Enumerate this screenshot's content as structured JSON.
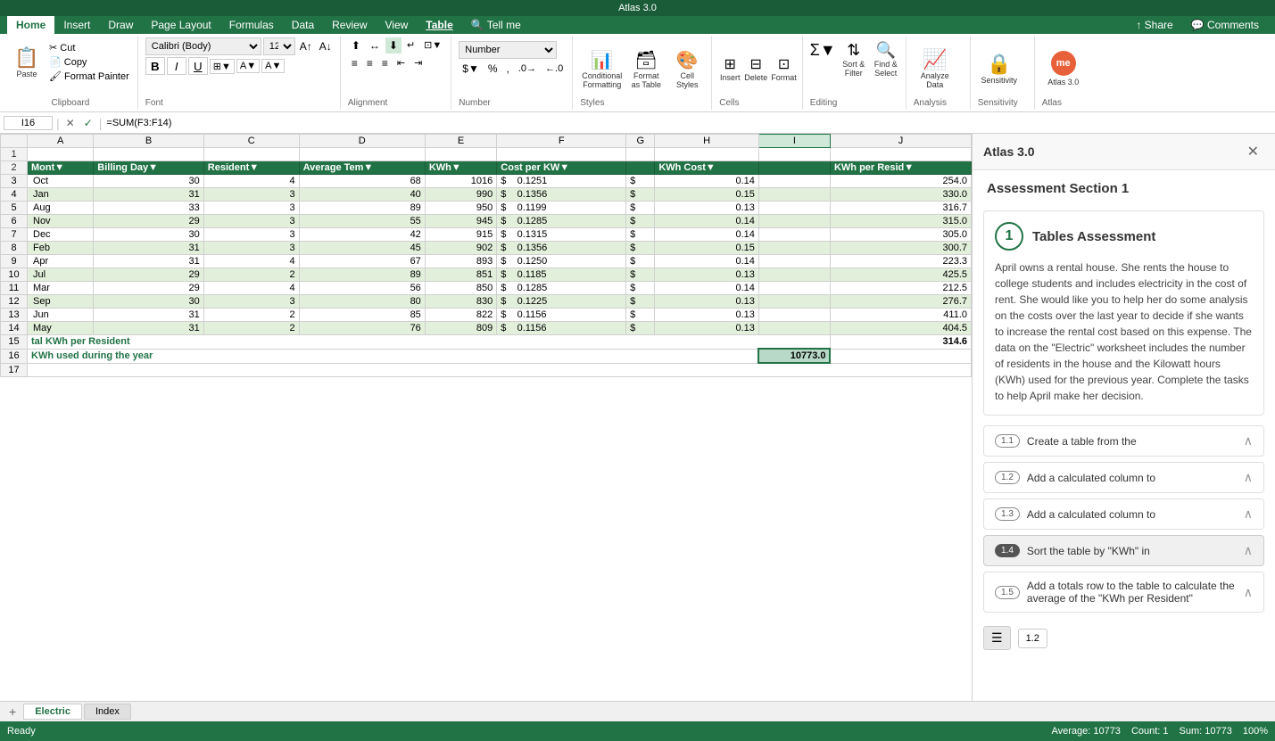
{
  "app": {
    "title": "Atlas 3.0",
    "close_label": "✕"
  },
  "ribbon": {
    "tabs": [
      "Home",
      "Insert",
      "Draw",
      "Page Layout",
      "Formulas",
      "Data",
      "Review",
      "View",
      "Table",
      "Tell me"
    ],
    "active_tab": "Home",
    "table_tab": "Table",
    "font_name": "Calibri (Body)",
    "font_size": "12",
    "number_format": "Number",
    "groups": {
      "clipboard": "Clipboard",
      "font": "Font",
      "alignment": "Alignment",
      "number": "Number",
      "styles": "Styles",
      "cells": "Cells",
      "editing": "Editing",
      "analysis": "Analysis",
      "sensitivity": "Sensitivity",
      "atlas": "Atlas"
    },
    "buttons": {
      "paste": "Paste",
      "conditional_formatting": "Conditional Formatting",
      "format_as_table": "Format as Table",
      "cell_styles": "Cell Styles",
      "insert": "Insert",
      "delete": "Delete",
      "format": "Format",
      "sum": "Σ",
      "sort_filter": "Sort & Filter",
      "find_select": "Find & Select",
      "analyze_data": "Analyze Data",
      "sensitivity": "Sensitivity",
      "atlas": "Atlas 3.0"
    }
  },
  "formula_bar": {
    "cell_ref": "I16",
    "check": "✓",
    "cancel": "✕",
    "formula": "=SUM(F3:F14)"
  },
  "spreadsheet": {
    "col_headers": [
      "",
      "A",
      "B",
      "C",
      "D",
      "E",
      "F",
      "G",
      "H",
      "I"
    ],
    "table_headers": [
      "Mont▼",
      "Billing Da▼",
      "Resident▼",
      "Average Tem▼",
      "KWh▼",
      "Cost per KW▼",
      "",
      "KWh Cost▼",
      "",
      "KWh per Resid▼"
    ],
    "rows": [
      {
        "row": 2,
        "is_header": true,
        "cells": [
          "Oct",
          "30",
          "4",
          "68",
          "1016",
          "$",
          "0.1251",
          "$",
          "0.14",
          "254.0"
        ]
      },
      {
        "row": 3,
        "is_header": false,
        "odd": false,
        "cells": [
          "Jan",
          "31",
          "3",
          "40",
          "990",
          "$",
          "0.1356",
          "$",
          "0.15",
          "330.0"
        ]
      },
      {
        "row": 4,
        "is_header": false,
        "odd": true,
        "cells": [
          "Aug",
          "33",
          "3",
          "89",
          "950",
          "$",
          "0.1199",
          "$",
          "0.13",
          "316.7"
        ]
      },
      {
        "row": 5,
        "is_header": false,
        "odd": false,
        "cells": [
          "Nov",
          "29",
          "3",
          "55",
          "945",
          "$",
          "0.1285",
          "$",
          "0.14",
          "315.0"
        ]
      },
      {
        "row": 6,
        "is_header": false,
        "odd": true,
        "cells": [
          "Dec",
          "30",
          "3",
          "42",
          "915",
          "$",
          "0.1315",
          "$",
          "0.14",
          "305.0"
        ]
      },
      {
        "row": 7,
        "is_header": false,
        "odd": false,
        "cells": [
          "Feb",
          "31",
          "3",
          "45",
          "902",
          "$",
          "0.1356",
          "$",
          "0.15",
          "300.7"
        ]
      },
      {
        "row": 8,
        "is_header": false,
        "odd": true,
        "cells": [
          "Apr",
          "31",
          "4",
          "67",
          "893",
          "$",
          "0.1250",
          "$",
          "0.14",
          "223.3"
        ]
      },
      {
        "row": 9,
        "is_header": false,
        "odd": false,
        "cells": [
          "Jul",
          "29",
          "2",
          "89",
          "851",
          "$",
          "0.1185",
          "$",
          "0.13",
          "425.5"
        ]
      },
      {
        "row": 10,
        "is_header": false,
        "odd": true,
        "cells": [
          "Mar",
          "29",
          "4",
          "56",
          "850",
          "$",
          "0.1285",
          "$",
          "0.14",
          "212.5"
        ]
      },
      {
        "row": 11,
        "is_header": false,
        "odd": false,
        "cells": [
          "Sep",
          "30",
          "3",
          "80",
          "830",
          "$",
          "0.1225",
          "$",
          "0.13",
          "276.7"
        ]
      },
      {
        "row": 12,
        "is_header": false,
        "odd": true,
        "cells": [
          "Jun",
          "31",
          "2",
          "85",
          "822",
          "$",
          "0.1156",
          "$",
          "0.13",
          "411.0"
        ]
      },
      {
        "row": 13,
        "is_header": false,
        "odd": false,
        "cells": [
          "May",
          "31",
          "2",
          "76",
          "809",
          "$",
          "0.1156",
          "$",
          "0.13",
          "404.5"
        ]
      }
    ],
    "summary_rows": [
      {
        "row": 15,
        "label": "tal KWh per Resident",
        "col_a_label": "tal KWh per Resident",
        "value": "314.6",
        "value_col": "I"
      },
      {
        "row": 16,
        "label": "KWh used during the year",
        "col_a_label": "KWh used during the year",
        "value": "10773.0",
        "value_col": "I",
        "selected": true
      }
    ]
  },
  "sheet_tabs": [
    "Electric",
    "Index"
  ],
  "active_sheet": "Electric",
  "panel": {
    "title": "Atlas 3.0",
    "section_title": "Assessment Section 1",
    "assessment": {
      "number": "1",
      "title": "Tables Assessment",
      "body": "April owns a rental house. She rents the house to college students and includes electricity in the cost of rent. She would like you to help her do some analysis on the costs over the last year to decide if she wants to increase the rental cost based on this expense. The data on the \"Electric\" worksheet includes the number of residents in the house and the Kilowatt hours (KWh) used for the previous year. Complete the tasks to help April make her decision."
    },
    "tasks": [
      {
        "id": "1.1",
        "label": "Create a table from the",
        "active": false,
        "dark": false
      },
      {
        "id": "1.2",
        "label": "Add a calculated column to",
        "active": false,
        "dark": false
      },
      {
        "id": "1.3",
        "label": "Add a calculated column to",
        "active": false,
        "dark": false
      },
      {
        "id": "1.4",
        "label": "Sort the table by \"KWh\" in",
        "active": true,
        "dark": true
      },
      {
        "id": "1.5",
        "label": "Add a totals row to the table to calculate the average of the \"KWh per Resident\"",
        "active": false,
        "dark": false
      }
    ]
  },
  "status_bar": {
    "left": [
      "Ready"
    ],
    "sum_label": "Average: 10773",
    "count_label": "Count: 1",
    "sum2_label": "Sum: 10773",
    "zoom": "100%"
  }
}
